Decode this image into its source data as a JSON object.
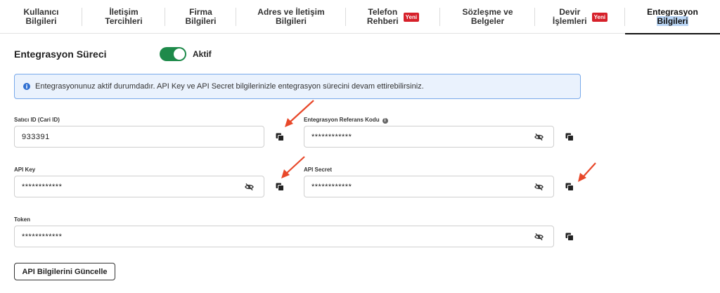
{
  "tabs": [
    {
      "line1": "Kullanıcı",
      "line2": "Bilgileri",
      "badge": ""
    },
    {
      "line1": "İletişim",
      "line2": "Tercihleri",
      "badge": ""
    },
    {
      "line1": "Firma",
      "line2": "Bilgileri",
      "badge": ""
    },
    {
      "line1": "Adres ve İletişim",
      "line2": "Bilgileri",
      "badge": ""
    },
    {
      "line1": "Telefon",
      "line2": "Rehberi",
      "badge": "Yeni"
    },
    {
      "line1": "Sözleşme ve",
      "line2": "Belgeler",
      "badge": ""
    },
    {
      "line1": "Devir",
      "line2": "İşlemleri",
      "badge": "Yeni"
    },
    {
      "line1": "Entegrasyon",
      "line2": "Bilgileri",
      "badge": "",
      "active": true
    }
  ],
  "process": {
    "label": "Entegrasyon Süreci",
    "toggle_on": true,
    "toggle_text": "Aktif"
  },
  "info": {
    "icon": "info-icon",
    "text": "Entegrasyonunuz aktif durumdadır. API Key ve API Secret bilgilerinizle entegrasyon sürecini devam ettirebilirsiniz."
  },
  "fields": {
    "seller_id": {
      "label": "Satıcı ID (Cari ID)",
      "value": "933391"
    },
    "ref_code": {
      "label": "Entegrasyon Referans Kodu",
      "value": "************"
    },
    "api_key": {
      "label": "API Key",
      "value": "************"
    },
    "api_secret": {
      "label": "API Secret",
      "value": "************"
    },
    "token": {
      "label": "Token",
      "value": "************"
    }
  },
  "actions": {
    "update_label": "API Bilgilerini Güncelle"
  },
  "colors": {
    "toggle": "#1e8a4a",
    "badge": "#d6202a",
    "info_border": "#79a9ea",
    "info_bg": "#eaf2fd",
    "arrow": "#e8482a"
  }
}
